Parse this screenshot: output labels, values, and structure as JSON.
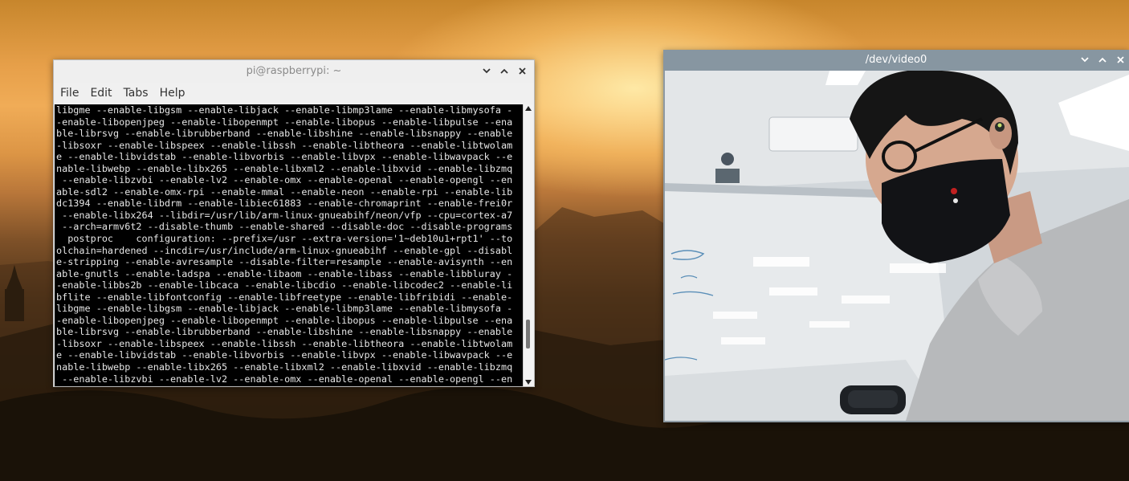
{
  "desktop": {
    "wallpaper": "sunset landscape with pagoda silhouettes"
  },
  "terminal": {
    "title": "pi@raspberrypi: ~",
    "menu": [
      "File",
      "Edit",
      "Tabs",
      "Help"
    ],
    "lines": [
      "libgme --enable-libgsm --enable-libjack --enable-libmp3lame --enable-libmysofa -",
      "-enable-libopenjpeg --enable-libopenmpt --enable-libopus --enable-libpulse --ena",
      "ble-librsvg --enable-librubberband --enable-libshine --enable-libsnappy --enable",
      "-libsoxr --enable-libspeex --enable-libssh --enable-libtheora --enable-libtwolam",
      "e --enable-libvidstab --enable-libvorbis --enable-libvpx --enable-libwavpack --e",
      "nable-libwebp --enable-libx265 --enable-libxml2 --enable-libxvid --enable-libzmq",
      " --enable-libzvbi --enable-lv2 --enable-omx --enable-openal --enable-opengl --en",
      "able-sdl2 --enable-omx-rpi --enable-mmal --enable-neon --enable-rpi --enable-lib",
      "dc1394 --enable-libdrm --enable-libiec61883 --enable-chromaprint --enable-frei0r",
      " --enable-libx264 --libdir=/usr/lib/arm-linux-gnueabihf/neon/vfp --cpu=cortex-a7",
      " --arch=armv6t2 --disable-thumb --enable-shared --disable-doc --disable-programs",
      "  postproc    configuration: --prefix=/usr --extra-version='1~deb10u1+rpt1' --to",
      "olchain=hardened --incdir=/usr/include/arm-linux-gnueabihf --enable-gpl --disabl",
      "e-stripping --enable-avresample --disable-filter=resample --enable-avisynth --en",
      "able-gnutls --enable-ladspa --enable-libaom --enable-libass --enable-libbluray -",
      "-enable-libbs2b --enable-libcaca --enable-libcdio --enable-libcodec2 --enable-li",
      "bflite --enable-libfontconfig --enable-libfreetype --enable-libfribidi --enable-",
      "libgme --enable-libgsm --enable-libjack --enable-libmp3lame --enable-libmysofa -",
      "-enable-libopenjpeg --enable-libopenmpt --enable-libopus --enable-libpulse --ena",
      "ble-librsvg --enable-librubberband --enable-libshine --enable-libsnappy --enable",
      "-libsoxr --enable-libspeex --enable-libssh --enable-libtheora --enable-libtwolam",
      "e --enable-libvidstab --enable-libvorbis --enable-libvpx --enable-libwavpack --e",
      "nable-libwebp --enable-libx265 --enable-libxml2 --enable-libxvid --enable-libzmq",
      " --enable-libzvbi --enable-lv2 --enable-omx --enable-openal --enable-opengl --en"
    ]
  },
  "video": {
    "title": "/dev/video0"
  },
  "icons": {
    "minimize": "chevron-down-icon",
    "maximize": "chevron-up-icon",
    "close": "close-icon"
  },
  "colors": {
    "terminal_bg": "#000000",
    "terminal_fg": "#e6e6e6",
    "video_titlebar": "#8796a1",
    "terminal_titlebar": "#efefef"
  }
}
